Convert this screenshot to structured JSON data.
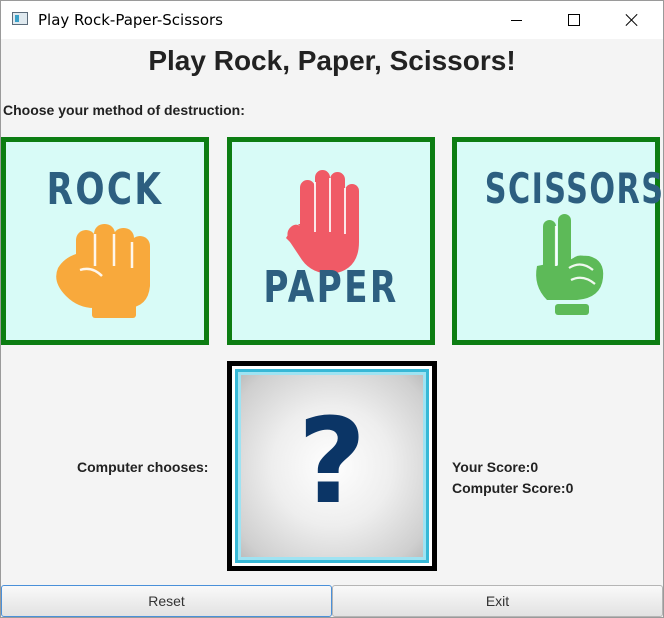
{
  "window": {
    "title": "Play Rock-Paper-Scissors",
    "icons": {
      "app": "app-window-icon",
      "minimize": "minimize-icon",
      "maximize": "maximize-icon",
      "close": "close-icon"
    }
  },
  "header": {
    "title": "Play Rock, Paper, Scissors!"
  },
  "prompt": "Choose your method of destruction:",
  "choices": [
    {
      "label": "ROCK",
      "icon": "fist-icon",
      "color": "#f8a93c"
    },
    {
      "label": "PAPER",
      "icon": "open-hand-icon",
      "color": "#f05a66"
    },
    {
      "label": "SCISSORS",
      "icon": "peace-hand-icon",
      "color": "#5dba58"
    }
  ],
  "computer": {
    "label": "Computer chooses:",
    "placeholder_symbol": "?"
  },
  "scores": {
    "you": "Your Score:0",
    "computer": "Computer Score:0"
  },
  "buttons": {
    "reset": "Reset",
    "exit": "Exit"
  },
  "colors": {
    "choice_border": "#0c7d12",
    "choice_bg": "#d8fbf7",
    "label_text": "#2d5f80",
    "question_mark": "#0b3566"
  }
}
